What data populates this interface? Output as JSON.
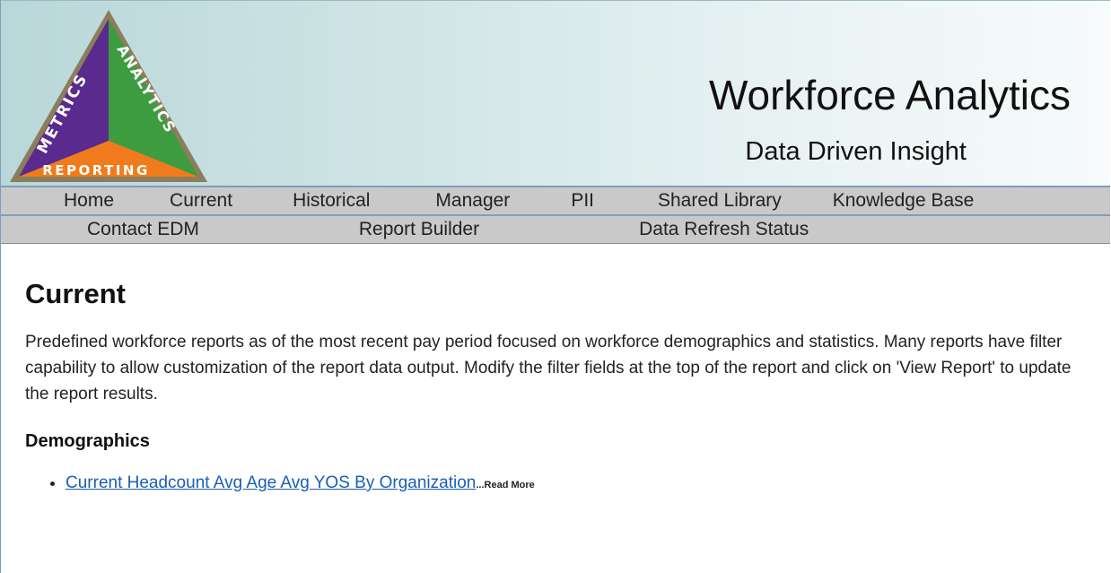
{
  "header": {
    "logo": {
      "left_label": "METRICS",
      "right_label": "ANALYTICS",
      "bottom_label": "REPORTING",
      "colors": {
        "purple": "#5b2a8c",
        "green": "#3a9a3a",
        "orange": "#f07a1a",
        "border": "#8a7a5a"
      }
    },
    "title": "Workforce Analytics",
    "subtitle": "Data Driven Insight"
  },
  "nav": {
    "row1": [
      "Home",
      "Current",
      "Historical",
      "Manager",
      "PII",
      "Shared Library",
      "Knowledge Base"
    ],
    "row2": [
      "Contact EDM",
      "Report Builder",
      "Data Refresh Status"
    ]
  },
  "main": {
    "title": "Current",
    "description": "Predefined workforce reports as of the most recent pay period focused on workforce demographics and statistics. Many reports have filter capability to allow customization of the report data output. Modify the filter fields at the top of the report and click on 'View Report' to update the report results.",
    "sections": [
      {
        "title": "Demographics",
        "reports": [
          {
            "label": "Current Headcount Avg Age Avg YOS By Organization",
            "more": "...Read More"
          }
        ]
      }
    ]
  },
  "colors": {
    "nav_bg": "#c9c9c9",
    "nav_border": "#7f9db9",
    "link": "#1a5fb4"
  }
}
